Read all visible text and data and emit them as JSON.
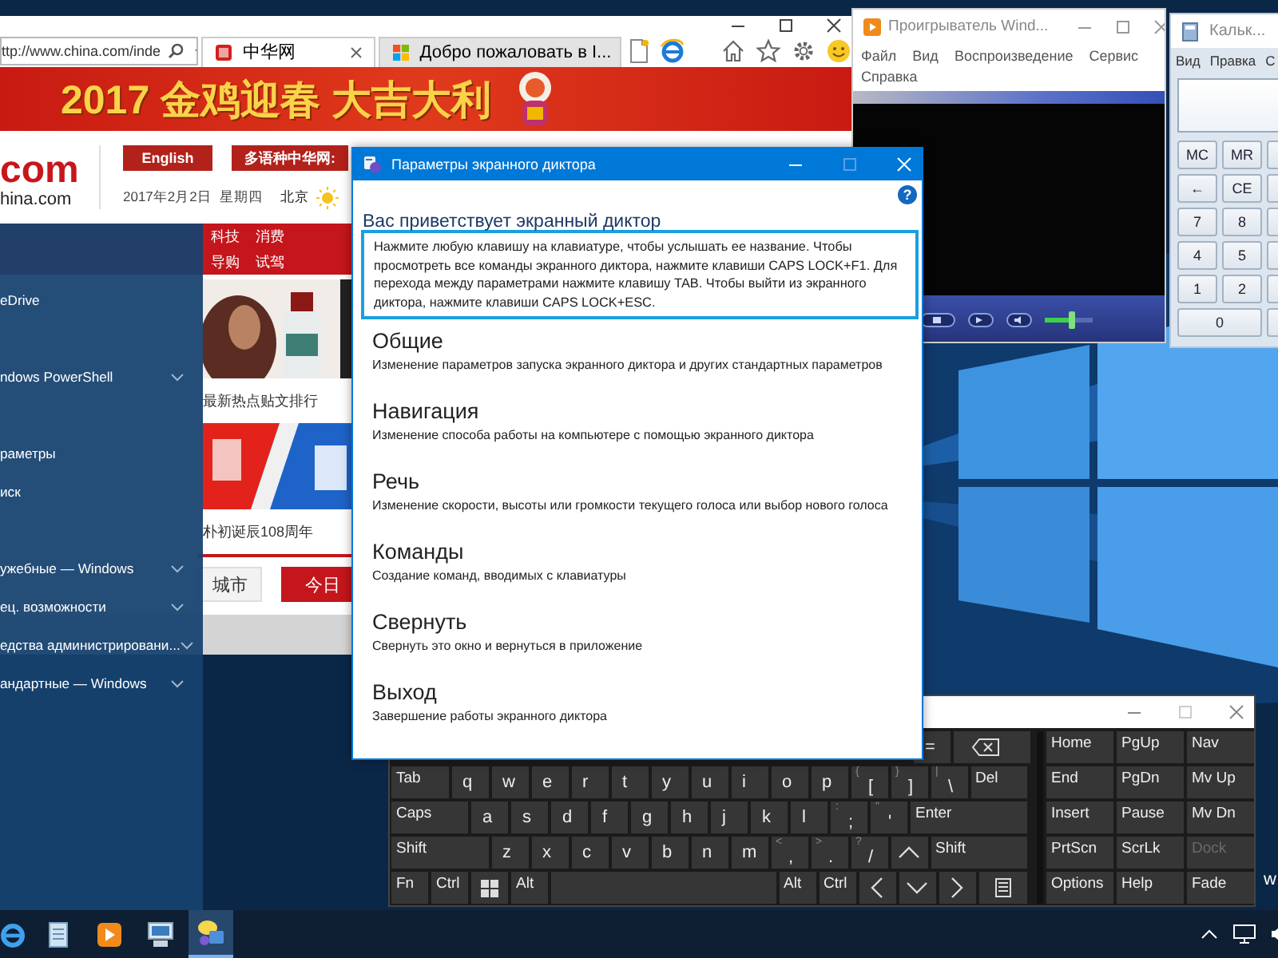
{
  "browser": {
    "address": "ttp://www.china.com/inde",
    "tabs": [
      {
        "label": "中华网",
        "selected": true
      },
      {
        "label": "Добро пожаловать в I...",
        "selected": false
      }
    ],
    "page": {
      "banner": "2017 金鸡迎春 大吉大利",
      "logo": "com",
      "logo_domain": "hina.com",
      "buttons": [
        "English",
        "多语种中华网:"
      ],
      "date": "2017年2月2日",
      "weekday": "星期四",
      "city": "北京",
      "nav": [
        "科技",
        "消费",
        "导购",
        "试驾"
      ],
      "headlines": [
        "最新热点贴文排行",
        "朴初诞辰108周年"
      ],
      "tabs": [
        {
          "label": "城市",
          "selected": false
        },
        {
          "label": "今日",
          "selected": true
        }
      ]
    }
  },
  "start_menu": {
    "groups": [
      [
        {
          "label": "eDrive",
          "expandable": false
        }
      ],
      [
        {
          "label": "ndows PowerShell",
          "expandable": true
        }
      ],
      [
        {
          "label": "раметры",
          "expandable": false
        },
        {
          "label": "иск",
          "expandable": false
        }
      ],
      [
        {
          "label": "ужебные — Windows",
          "expandable": true
        },
        {
          "label": "ец. возможности",
          "expandable": true
        },
        {
          "label": "едства администрировани...",
          "expandable": true
        },
        {
          "label": "андартные — Windows",
          "expandable": true
        }
      ]
    ]
  },
  "media_player": {
    "title": "Проигрыватель Wind...",
    "menu": [
      "Файл",
      "Вид",
      "Воспроизведение",
      "Сервис",
      "Справка"
    ],
    "volume": {
      "level": 0.55
    }
  },
  "calculator": {
    "title": "Кальк...",
    "menu": [
      "Вид",
      "Правка",
      "С"
    ],
    "keys": [
      [
        "MC",
        "MR"
      ],
      [
        "←",
        "CE"
      ],
      [
        "7",
        "8"
      ],
      [
        "4",
        "5"
      ],
      [
        "1",
        "2"
      ],
      [
        "0"
      ]
    ]
  },
  "narrator": {
    "title": "Параметры экранного диктора",
    "help": "?",
    "heading": "Вас приветствует экранный диктор",
    "intro": "Нажмите любую клавишу на клавиатуре, чтобы услышать ее название. Чтобы просмотреть все команды экранного диктора, нажмите клавиши CAPS LOCK+F1. Для перехода между параметрами нажмите клавишу TAB. Чтобы выйти из экранного диктора, нажмите клавиши CAPS LOCK+ESC.",
    "sections": [
      {
        "title": "Общие",
        "description": "Изменение параметров запуска экранного диктора и других стандартных параметров"
      },
      {
        "title": "Навигация",
        "description": "Изменение способа работы на компьютере с помощью экранного диктора"
      },
      {
        "title": "Речь",
        "description": "Изменение скорости, высоты или громкости текущего голоса или выбор нового голоса"
      },
      {
        "title": "Команды",
        "description": "Создание команд, вводимых с клавиатуры"
      },
      {
        "title": "Свернуть",
        "description": "Свернуть это окно и вернуться в приложение"
      },
      {
        "title": "Выход",
        "description": "Завершение работы экранного диктора"
      }
    ]
  },
  "keyboard": {
    "rows": [
      {
        "keys": [
          {
            "kind": "char",
            "label": "="
          },
          {
            "kind": "backspace"
          }
        ]
      },
      {
        "keys": [
          {
            "kind": "tab",
            "label": "Tab"
          },
          {
            "kind": "char",
            "label": "q"
          },
          {
            "kind": "char",
            "label": "w"
          },
          {
            "kind": "char",
            "label": "e"
          },
          {
            "kind": "char",
            "label": "r"
          },
          {
            "kind": "char",
            "label": "t"
          },
          {
            "kind": "char",
            "label": "y"
          },
          {
            "kind": "char",
            "label": "u"
          },
          {
            "kind": "char",
            "label": "i"
          },
          {
            "kind": "char",
            "label": "o"
          },
          {
            "kind": "char",
            "label": "p"
          },
          {
            "kind": "char",
            "label": "[",
            "upper": "{"
          },
          {
            "kind": "char",
            "label": "]",
            "upper": "}"
          },
          {
            "kind": "char",
            "label": "\\",
            "upper": "|"
          },
          {
            "kind": "del",
            "label": "Del"
          }
        ]
      },
      {
        "keys": [
          {
            "kind": "caps",
            "label": "Caps"
          },
          {
            "kind": "char",
            "label": "a"
          },
          {
            "kind": "char",
            "label": "s"
          },
          {
            "kind": "char",
            "label": "d"
          },
          {
            "kind": "char",
            "label": "f"
          },
          {
            "kind": "char",
            "label": "g"
          },
          {
            "kind": "char",
            "label": "h"
          },
          {
            "kind": "char",
            "label": "j"
          },
          {
            "kind": "char",
            "label": "k"
          },
          {
            "kind": "char",
            "label": "l"
          },
          {
            "kind": "char",
            "label": ";",
            "upper": ":"
          },
          {
            "kind": "char",
            "label": "'",
            "upper": "\""
          },
          {
            "kind": "enter",
            "label": "Enter"
          }
        ]
      },
      {
        "keys": [
          {
            "kind": "shift",
            "label": "Shift"
          },
          {
            "kind": "char",
            "label": "z"
          },
          {
            "kind": "char",
            "label": "x"
          },
          {
            "kind": "char",
            "label": "c"
          },
          {
            "kind": "char",
            "label": "v"
          },
          {
            "kind": "char",
            "label": "b"
          },
          {
            "kind": "char",
            "label": "n"
          },
          {
            "kind": "char",
            "label": "m"
          },
          {
            "kind": "char",
            "label": ",",
            "upper": "<"
          },
          {
            "kind": "char",
            "label": ".",
            "upper": ">"
          },
          {
            "kind": "char",
            "label": "/",
            "upper": "?"
          },
          {
            "kind": "up"
          },
          {
            "kind": "shift",
            "label": "Shift"
          }
        ]
      },
      {
        "keys": [
          {
            "kind": "mod",
            "label": "Fn"
          },
          {
            "kind": "mod",
            "label": "Ctrl"
          },
          {
            "kind": "win"
          },
          {
            "kind": "mod",
            "label": "Alt"
          },
          {
            "kind": "space"
          },
          {
            "kind": "mod",
            "label": "Alt"
          },
          {
            "kind": "mod",
            "label": "Ctrl"
          },
          {
            "kind": "left"
          },
          {
            "kind": "down"
          },
          {
            "kind": "right"
          },
          {
            "kind": "menu"
          }
        ]
      }
    ],
    "nav_keys": [
      [
        {
          "label": "Home",
          "disabled": false
        },
        {
          "label": "PgUp",
          "disabled": false
        },
        {
          "label": "Nav",
          "disabled": false
        }
      ],
      [
        {
          "label": "End",
          "disabled": false
        },
        {
          "label": "PgDn",
          "disabled": false
        },
        {
          "label": "Mv Up",
          "disabled": false
        }
      ],
      [
        {
          "label": "Insert",
          "disabled": false
        },
        {
          "label": "Pause",
          "disabled": false
        },
        {
          "label": "Mv Dn",
          "disabled": false
        }
      ],
      [
        {
          "label": "PrtScn",
          "disabled": false
        },
        {
          "label": "ScrLk",
          "disabled": false
        },
        {
          "label": "Dock",
          "disabled": true
        }
      ],
      [
        {
          "label": "Options",
          "disabled": false
        },
        {
          "label": "Help",
          "disabled": false
        },
        {
          "label": "Fade",
          "disabled": false
        }
      ]
    ]
  },
  "desktop_text": "w",
  "taskbar": {
    "apps": [
      {
        "kind": "browser",
        "active": false
      },
      {
        "kind": "notepad",
        "active": false
      },
      {
        "kind": "player",
        "active": false
      },
      {
        "kind": "network",
        "active": false
      },
      {
        "kind": "narrator",
        "active": true
      }
    ]
  }
}
